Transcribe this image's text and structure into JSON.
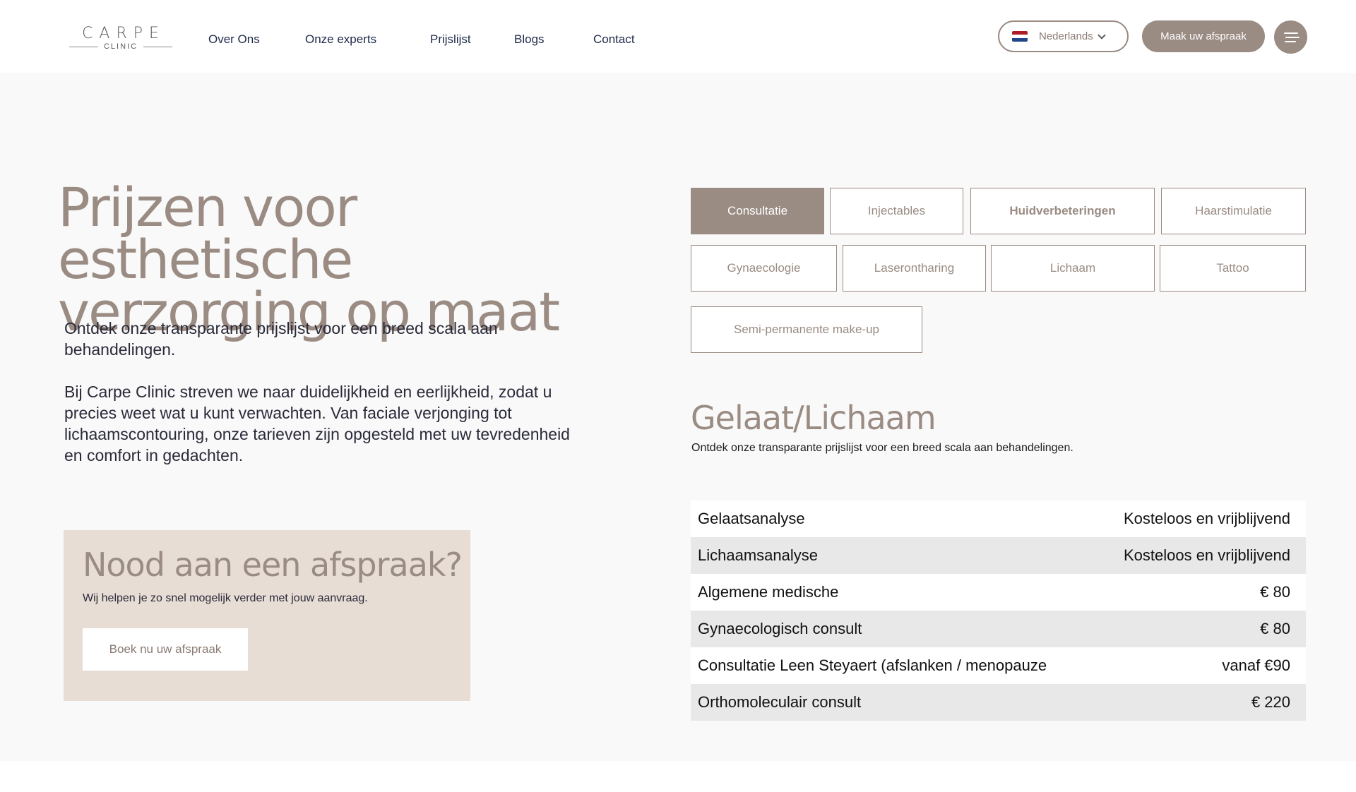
{
  "header": {
    "logo": {
      "word": "CARPE",
      "sub": "CLINIC"
    },
    "nav": [
      "Over Ons",
      "Onze experts",
      "Prijslijst",
      "Blogs",
      "Contact"
    ],
    "language": {
      "label": "Nederlands",
      "flag_colors": [
        "#AE1C28",
        "#FFFFFF",
        "#21468B"
      ]
    },
    "cta_label": "Maak uw afspraak"
  },
  "hero": {
    "title": "Prijzen voor esthetische verzorging op maat",
    "intro": "Ontdek onze transparante prijslijst voor een breed scala aan behandelingen.",
    "intro2": "Bij Carpe Clinic streven we naar duidelijkheid en eerlijkheid, zodat u precies weet wat u kunt verwachten. Van faciale verjonging tot lichaamscontouring, onze tarieven zijn opgesteld met uw tevredenheid en comfort in gedachten."
  },
  "appointment": {
    "title": "Nood aan een afspraak?",
    "subtitle": "Wij helpen je zo snel mogelijk verder met jouw aanvraag.",
    "button": "Boek nu uw afspraak"
  },
  "tabs": [
    {
      "label": "Consultatie",
      "active": true
    },
    {
      "label": "Injectables",
      "active": false
    },
    {
      "label": "Huidverbeteringen",
      "active": false
    },
    {
      "label": "Haarstimulatie",
      "active": false
    },
    {
      "label": "Gynaecologie",
      "active": false
    },
    {
      "label": "Laserontharing",
      "active": false
    },
    {
      "label": "Lichaam",
      "active": false
    },
    {
      "label": "Tattoo",
      "active": false
    },
    {
      "label": "Semi-permanente make-up",
      "active": false
    }
  ],
  "section": {
    "title": "Gelaat/Lichaam",
    "subtitle": "Ontdek onze transparante prijslijst voor een breed scala aan behandelingen."
  },
  "prices": [
    {
      "name": "Gelaatsanalyse",
      "price": "Kosteloos en vrijblijvend"
    },
    {
      "name": "Lichaamsanalyse",
      "price": "Kosteloos en vrijblijvend"
    },
    {
      "name": "Algemene medische",
      "price": "€ 80"
    },
    {
      "name": "Gynaecologisch consult",
      "price": "€ 80"
    },
    {
      "name": "Consultatie Leen Steyaert (afslanken / menopauze",
      "price": "vanaf €90"
    },
    {
      "name": "Orthomoleculair consult",
      "price": "€ 220"
    }
  ],
  "colors": {
    "accent": "#9A8B83",
    "nav_text": "#1E2A4A",
    "appointment_bg": "#E7DDD5",
    "row_alt": "#E8E8E8"
  }
}
